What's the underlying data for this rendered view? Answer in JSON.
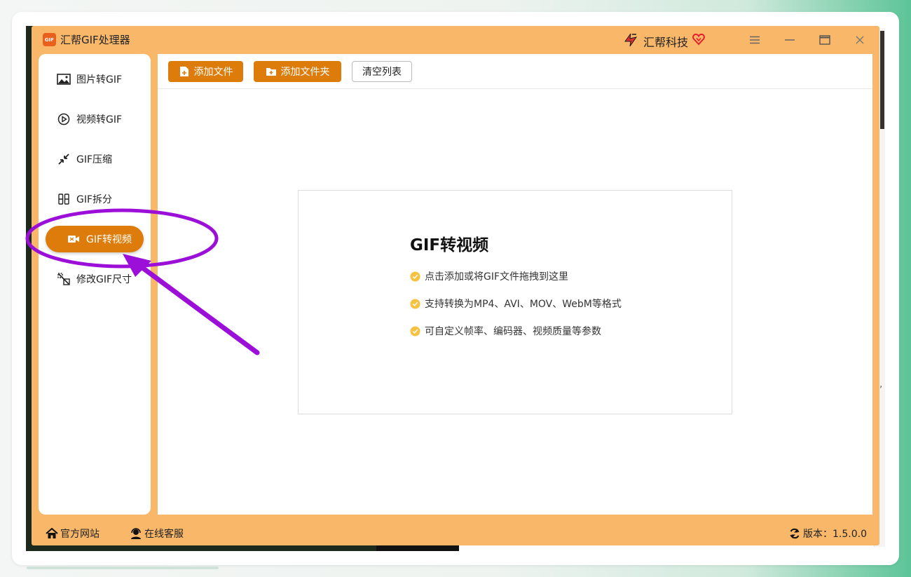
{
  "app": {
    "logo_text": "GIF",
    "title": "汇帮GIF处理器",
    "brand_name": "汇帮科技"
  },
  "window_controls": {
    "menu": "≡",
    "minimize": "—",
    "maximize": "□",
    "close": "×"
  },
  "sidebar": {
    "items": [
      {
        "label": "图片转GIF",
        "icon": "image-icon"
      },
      {
        "label": "视频转GIF",
        "icon": "play-circle-icon"
      },
      {
        "label": "GIF压缩",
        "icon": "compress-icon"
      },
      {
        "label": "GIF拆分",
        "icon": "split-icon"
      },
      {
        "label": "GIF转视频",
        "icon": "video-icon",
        "active": true
      },
      {
        "label": "修改GIF尺寸",
        "icon": "resize-icon"
      }
    ]
  },
  "toolbar": {
    "add_file": "添加文件",
    "add_folder": "添加文件夹",
    "clear_list": "清空列表"
  },
  "drop_zone": {
    "title": "GIF转视频",
    "lines": [
      "点击添加或将GIF文件拖拽到这里",
      "支持转换为MP4、AVI、MOV、WebM等格式",
      "可自定义帧率、编码器、视频质量等参数"
    ]
  },
  "footer": {
    "website": "官方网站",
    "support": "在线客服",
    "version": "版本：1.5.0.0"
  },
  "background": {
    "edge_char": "],"
  },
  "colors": {
    "window_bg": "#f8b769",
    "accent": "#dd7c0a",
    "annotation": "#9b0fd8",
    "check": "#f5c242"
  }
}
